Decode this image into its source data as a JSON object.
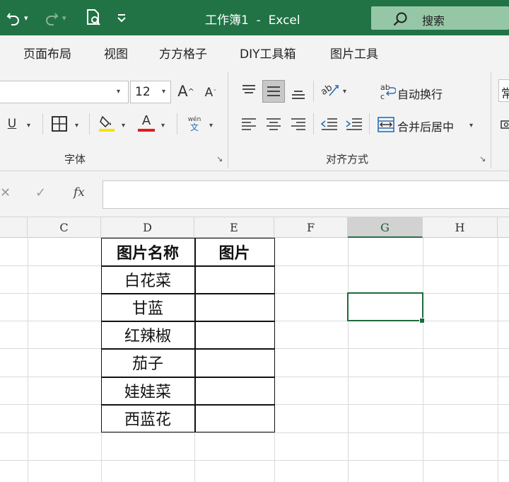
{
  "window": {
    "title": "工作簿1  -  Excel",
    "search_label": "搜索",
    "accent": "#217346"
  },
  "ribbon_tabs": [
    "页面布局",
    "视图",
    "方方格子",
    "DIY工具箱",
    "图片工具"
  ],
  "ribbon": {
    "font_name": "",
    "font_size": "12",
    "grow_font": "A",
    "shrink_font": "A",
    "underline": "U",
    "font_color_letter": "A",
    "phonetic_top": "wén",
    "phonetic_bottom": "文",
    "wrap_text": "自动换行",
    "merge_center": "合并后居中",
    "font_group": "字体",
    "align_group": "对齐方式",
    "clip_top": "常",
    "font_color": "#e31b1b",
    "highlight_color": "#f5e400"
  },
  "formula_bar": {
    "fx": "fx",
    "value": ""
  },
  "columns": [
    "C",
    "D",
    "E",
    "F",
    "G",
    "H"
  ],
  "active_column": "G",
  "table": {
    "headers": [
      "图片名称",
      "图片"
    ],
    "rows": [
      "白花菜",
      "甘蓝",
      "红辣椒",
      "茄子",
      "娃娃菜",
      "西蓝花"
    ]
  }
}
